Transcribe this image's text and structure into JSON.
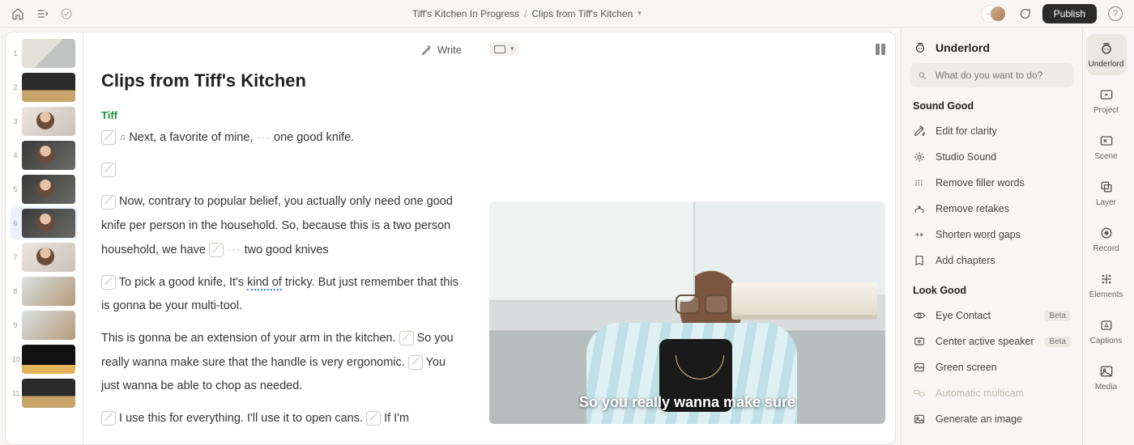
{
  "header": {
    "breadcrumb_project": "Tiff's Kitchen In Progress",
    "breadcrumb_title": "Clips from Tiff's Kitchen",
    "publish_label": "Publish"
  },
  "script_panel": {
    "write_label": "Write",
    "title": "Clips from Tiff's Kitchen",
    "speaker": "Tiff",
    "line1_a": "Next, a favorite of mine,",
    "line1_b": "one good knife.",
    "para2_a": "Now, contrary to popular belief, you actually only need one good knife per person in the household. So, because this is a two person household, we have",
    "para2_b": "two good knives",
    "para3_a": "To pick a good knife, It's",
    "para3_wave": "kind of",
    "para3_b": "tricky. But just remember that this is gonna be your multi-tool.",
    "para4_a": "This is gonna be an extension of your arm in the kitchen.",
    "para4_b": "So you really wanna make sure that the handle is very ergonomic.",
    "para4_c": "You just wanna be able to chop as needed.",
    "para5_a": "I use this for everything. I'll use it to open cans.",
    "para5_b": "If I'm"
  },
  "thumbnails": [
    "1",
    "2",
    "3",
    "4",
    "5",
    "6",
    "7",
    "8",
    "9",
    "10",
    "11"
  ],
  "thumbnails_active_index": 5,
  "preview": {
    "caption": "So you really wanna make sure"
  },
  "underlord": {
    "title": "Underlord",
    "search_placeholder": "What do you want to do?",
    "section1": "Sound Good",
    "items1": [
      "Edit for clarity",
      "Studio Sound",
      "Remove filler words",
      "Remove retakes",
      "Shorten word gaps",
      "Add chapters"
    ],
    "section2": "Look Good",
    "items2": [
      {
        "label": "Eye Contact",
        "badge": "Beta"
      },
      {
        "label": "Center active speaker",
        "badge": "Beta"
      },
      {
        "label": "Green screen"
      },
      {
        "label": "Automatic multicam",
        "disabled": true
      },
      {
        "label": "Generate an image"
      }
    ]
  },
  "rail": [
    "Underlord",
    "Project",
    "Scene",
    "Layer",
    "Record",
    "Elements",
    "Captions",
    "Media"
  ],
  "rail_active_index": 0
}
